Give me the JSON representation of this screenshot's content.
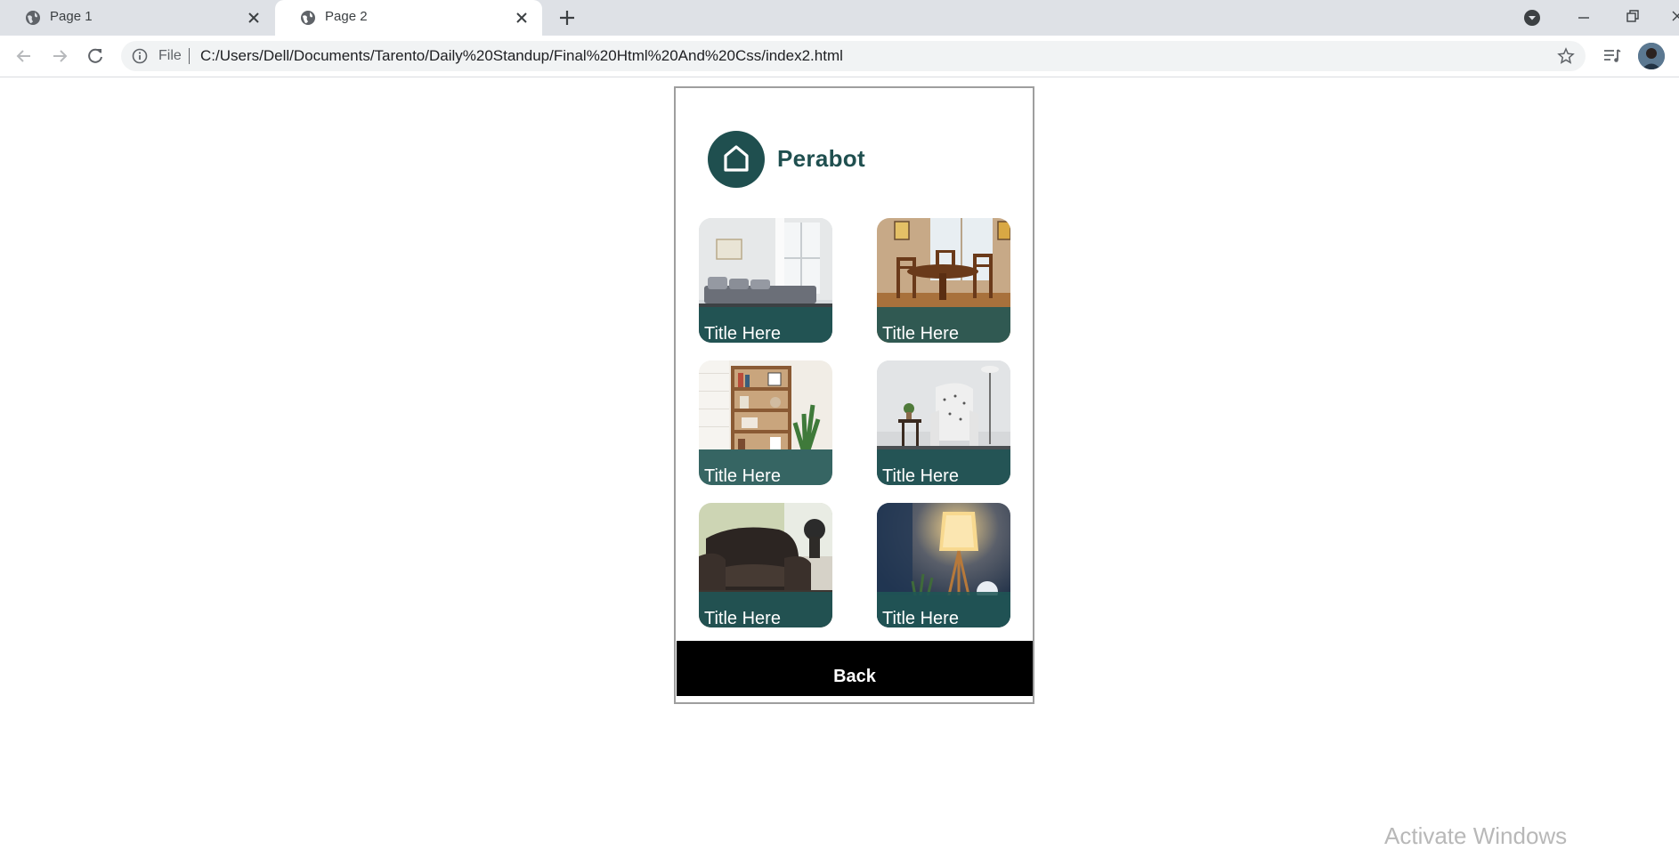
{
  "browser": {
    "tabs": [
      {
        "label": "Page 1",
        "active": false
      },
      {
        "label": "Page 2",
        "active": true
      }
    ],
    "address": {
      "scheme": "File",
      "url": "C:/Users/Dell/Documents/Tarento/Daily%20Standup/Final%20Html%20And%20Css/index2.html"
    }
  },
  "app": {
    "brand": "Perabot",
    "brand_color": "#1f4f4f",
    "cards": [
      {
        "title": "Title Here",
        "image": "living-room-sofa"
      },
      {
        "title": "Title Here",
        "image": "dining-table-set"
      },
      {
        "title": "Title Here",
        "image": "wooden-bookshelf"
      },
      {
        "title": "Title Here",
        "image": "patterned-armchair"
      },
      {
        "title": "Title Here",
        "image": "leather-recliner"
      },
      {
        "title": "Title Here",
        "image": "floor-lamp"
      }
    ],
    "back_label": "Back"
  },
  "os": {
    "watermark": "Activate Windows"
  }
}
